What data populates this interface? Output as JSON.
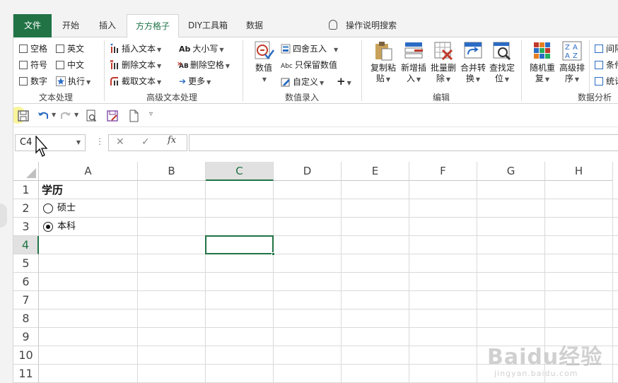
{
  "tabs": [
    {
      "label": "文件",
      "state": "file"
    },
    {
      "label": "开始",
      "state": ""
    },
    {
      "label": "插入",
      "state": ""
    },
    {
      "label": "方方格子",
      "state": "active"
    },
    {
      "label": "DIY工具箱",
      "state": ""
    },
    {
      "label": "数据",
      "state": ""
    }
  ],
  "tell_me": "操作说明搜索",
  "ribbon": {
    "text_processing": {
      "label": "文本处理",
      "checkboxes": [
        "空格",
        "英文",
        "符号",
        "中文",
        "数字"
      ],
      "execute": "执行"
    },
    "advanced_text": {
      "label": "高级文本处理",
      "insert_text": "插入文本",
      "delete_text": "删除文本",
      "extract_text": "截取文本",
      "case": "大小写",
      "delete_spaces": "删除空格",
      "more": "更多",
      "case_icon": "Ab",
      "spaces_icon": "AB"
    },
    "numeric_entry": {
      "label": "数值录入",
      "value_button": "数值",
      "round": "四舍五入",
      "keep_values": "只保留数值",
      "custom": "自定义",
      "keep_values_icon": "Abc"
    },
    "edit": {
      "label": "编辑",
      "buttons": [
        {
          "line1": "复制粘",
          "line2": "贴"
        },
        {
          "line1": "新增插",
          "line2": "入"
        },
        {
          "line1": "批量删",
          "line2": "除"
        },
        {
          "line1": "合并转",
          "line2": "换"
        },
        {
          "line1": "查找定",
          "line2": "位"
        }
      ]
    },
    "analysis": {
      "label": "数据分析",
      "buttons": [
        {
          "line1": "随机重",
          "line2": "复"
        },
        {
          "line1": "高级排",
          "line2": "序"
        }
      ],
      "side_items": [
        "间隔",
        "条件",
        "统计"
      ]
    }
  },
  "formula_bar": {
    "name_box": "C4",
    "fx": "fx",
    "value": ""
  },
  "sheet": {
    "columns": [
      "A",
      "B",
      "C",
      "D",
      "E",
      "F",
      "G",
      "H"
    ],
    "selected_column": "C",
    "rows": [
      "1",
      "2",
      "3",
      "4",
      "5",
      "6",
      "7",
      "8",
      "9",
      "10",
      "11"
    ],
    "selected_row": "4",
    "a1": "学历",
    "options": [
      {
        "label": "硕士",
        "checked": false
      },
      {
        "label": "本科",
        "checked": true
      }
    ]
  },
  "watermark": {
    "main": "Baidu经验",
    "sub": "jingyan.baidu.com"
  },
  "colors": {
    "accent": "#217346",
    "file_tab": "#217346",
    "highlight": "#f5f078"
  }
}
